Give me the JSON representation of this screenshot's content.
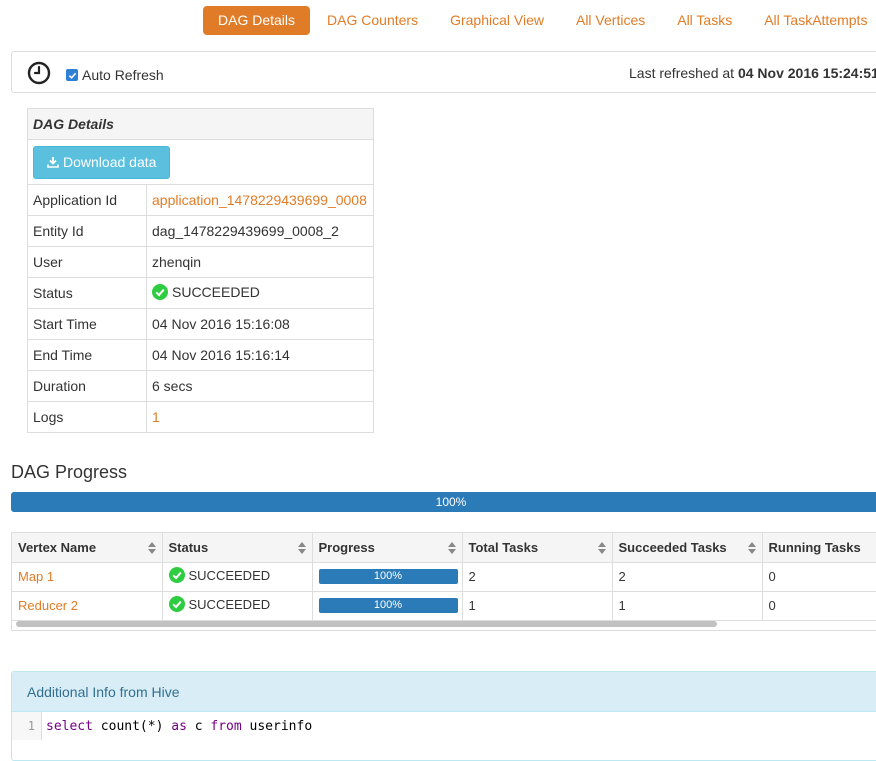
{
  "tabs": [
    {
      "label": "DAG Details",
      "active": true
    },
    {
      "label": "DAG Counters",
      "active": false
    },
    {
      "label": "Graphical View",
      "active": false
    },
    {
      "label": "All Vertices",
      "active": false
    },
    {
      "label": "All Tasks",
      "active": false
    },
    {
      "label": "All TaskAttempts",
      "active": false
    }
  ],
  "refresh": {
    "auto_refresh_label": "Auto Refresh",
    "auto_refresh_checked": true,
    "last_refreshed_prefix": "Last refreshed at ",
    "last_refreshed_time": "04 Nov 2016 15:24:51"
  },
  "details": {
    "title": "DAG Details",
    "download_label": "Download data",
    "rows": [
      {
        "key": "Application Id",
        "value": "application_1478229439699_0008",
        "link": true
      },
      {
        "key": "Entity Id",
        "value": "dag_1478229439699_0008_2"
      },
      {
        "key": "User",
        "value": "zhenqin"
      },
      {
        "key": "Status",
        "value": "SUCCEEDED",
        "status": true
      },
      {
        "key": "Start Time",
        "value": "04 Nov 2016 15:16:08"
      },
      {
        "key": "End Time",
        "value": "04 Nov 2016 15:16:14"
      },
      {
        "key": "Duration",
        "value": "6 secs"
      },
      {
        "key": "Logs",
        "value": "1",
        "link": true
      }
    ]
  },
  "progress": {
    "title": "DAG Progress",
    "value": 100,
    "label": "100%"
  },
  "vertices": {
    "columns": [
      "Vertex Name",
      "Status",
      "Progress",
      "Total Tasks",
      "Succeeded Tasks",
      "Running Tasks"
    ],
    "rows": [
      {
        "name": "Map 1",
        "status": "SUCCEEDED",
        "progress": "100%",
        "total": "2",
        "succeeded": "2",
        "running": "0"
      },
      {
        "name": "Reducer 2",
        "status": "SUCCEEDED",
        "progress": "100%",
        "total": "1",
        "succeeded": "1",
        "running": "0"
      }
    ]
  },
  "additional_info": {
    "title": "Additional Info from Hive",
    "line_number": "1",
    "query_tokens": [
      {
        "text": "select",
        "kw": true
      },
      {
        "text": " count(*) ",
        "kw": false
      },
      {
        "text": "as",
        "kw": true
      },
      {
        "text": " c ",
        "kw": false
      },
      {
        "text": "from",
        "kw": true
      },
      {
        "text": " userinfo",
        "kw": false
      }
    ]
  },
  "colors": {
    "accent": "#e07c27",
    "progress": "#2b7bb9",
    "success": "#2ecc40",
    "info_bg": "#d9edf7"
  }
}
